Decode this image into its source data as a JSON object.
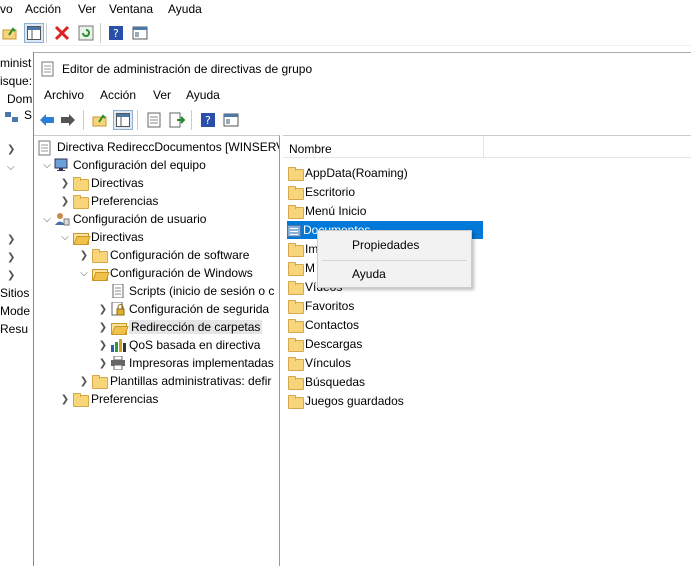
{
  "background_window": {
    "menu": [
      "vo",
      "Acción",
      "Ver",
      "Ventana",
      "Ayuda"
    ],
    "left_texts": [
      "ministrac",
      "isque:",
      "Dom",
      "S",
      "Sitios",
      "Mode",
      "Resu"
    ]
  },
  "window": {
    "title": "Editor de administración de directivas de grupo",
    "menu": [
      "Archivo",
      "Acción",
      "Ver",
      "Ayuda"
    ]
  },
  "tree": {
    "root": "Directiva RedireccDocumentos [WINSERV",
    "nodes": [
      {
        "label": "Configuración del equipo"
      },
      {
        "label": "Directivas"
      },
      {
        "label": "Preferencias"
      },
      {
        "label": "Configuración de usuario"
      },
      {
        "label": "Directivas"
      },
      {
        "label": "Configuración de software"
      },
      {
        "label": "Configuración de Windows"
      },
      {
        "label": "Scripts (inicio de sesión o c"
      },
      {
        "label": "Configuración de segurida"
      },
      {
        "label": "Redirección de carpetas"
      },
      {
        "label": "QoS basada en directiva"
      },
      {
        "label": "Impresoras implementadas"
      },
      {
        "label": "Plantillas administrativas: defir"
      },
      {
        "label": "Preferencias"
      }
    ]
  },
  "list": {
    "column_header": "Nombre",
    "items": [
      "AppData(Roaming)",
      "Escritorio",
      "Menú Inicio",
      "Documentos",
      "Im",
      "M",
      "Vídeos",
      "Favoritos",
      "Contactos",
      "Descargas",
      "Vínculos",
      "Búsquedas",
      "Juegos guardados"
    ],
    "selected_index": 3
  },
  "context_menu": {
    "items": [
      "Propiedades",
      "Ayuda"
    ]
  },
  "colors": {
    "selection": "#0078d7",
    "folder": "#f7d57a"
  }
}
